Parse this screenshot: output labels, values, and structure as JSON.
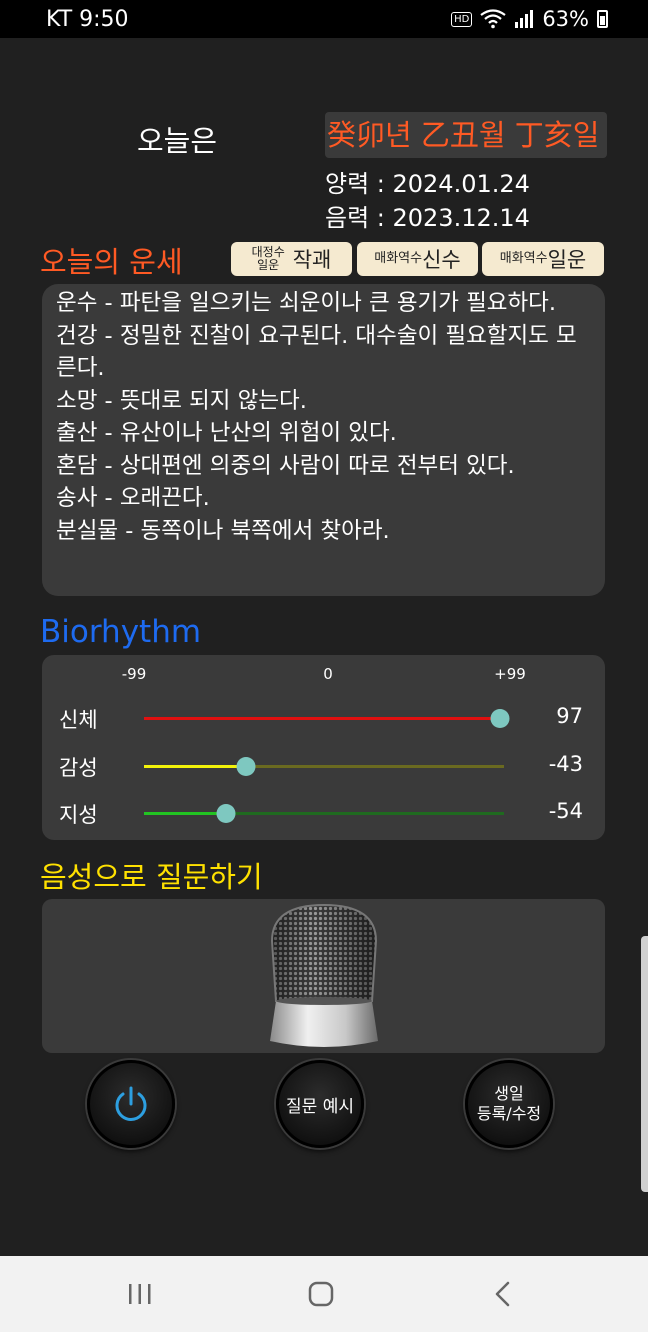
{
  "status_bar": {
    "carrier_time": "KT 9:50",
    "hd_badge": "HD",
    "battery": "63%"
  },
  "header": {
    "today_label": "오늘은",
    "ganji": "癸卯년 乙丑월 丁亥일",
    "solar_date": "양력 : 2024.01.24",
    "lunar_date": "음력 : 2023.12.14"
  },
  "fortune": {
    "title": "오늘의 운세",
    "chips": [
      {
        "small_top": "대정수",
        "small_bottom": "일운",
        "value": "작괘"
      },
      {
        "prefix": "매화역수",
        "value": "신수"
      },
      {
        "prefix": "매화역수",
        "value": "일운"
      }
    ],
    "lines": [
      "운수 - 파탄을 일으키는 쇠운이나 큰 용기가 필요하다.",
      "건강 - 정밀한 진찰이 요구된다. 대수술이 필요할지도 모른다.",
      "소망 - 뜻대로 되지 않는다.",
      "출산 - 유산이나 난산의 위험이 있다.",
      "혼담 - 상대편엔 의중의 사람이 따로 전부터 있다.",
      "송사 - 오래끈다.",
      "분실물 - 동쪽이나 북쪽에서 찾아라."
    ]
  },
  "biorhythm": {
    "title": "Biorhythm",
    "ticks": {
      "min": "-99",
      "mid": "0",
      "max": "+99"
    },
    "range": [
      -99,
      99
    ],
    "rows": [
      {
        "label": "신체",
        "value": 97,
        "value_text": "97",
        "color": "#e01010",
        "dim_color": "#6e1a1a"
      },
      {
        "label": "감성",
        "value": -43,
        "value_text": "-43",
        "color": "#f2f20a",
        "dim_color": "#6a6a20"
      },
      {
        "label": "지성",
        "value": -54,
        "value_text": "-54",
        "color": "#22c422",
        "dim_color": "#1f6a1f"
      }
    ]
  },
  "voice": {
    "title": "음성으로 질문하기",
    "mic_icon": "microphone-icon"
  },
  "buttons": {
    "power_icon": "power-icon",
    "example_label": "질문 예시",
    "birthday_line1": "생일",
    "birthday_line2": "등록/수정"
  },
  "colors": {
    "accent_orange": "#ff5a24",
    "accent_blue": "#1e6bf0",
    "accent_yellow": "#ffe100",
    "panel": "#3a3a3a",
    "background": "#202020",
    "thumb": "#7ec8c0"
  }
}
